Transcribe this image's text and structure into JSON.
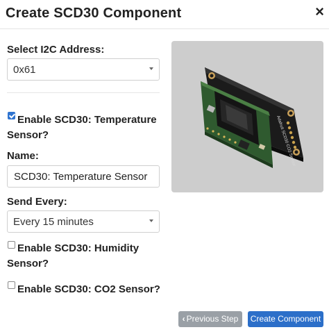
{
  "dialog": {
    "title": "Create SCD30 Component",
    "close_glyph": "×"
  },
  "form": {
    "i2c_label": "Select I2C Address:",
    "i2c_value": "0x61",
    "temp_checkbox": {
      "label": "Enable SCD30: Temperature Sensor?",
      "checked": true
    },
    "name_label": "Name:",
    "name_value": "SCD30: Temperature Sensor",
    "send_every_label": "Send Every:",
    "send_every_value": "Every 15 minutes",
    "humidity_checkbox": {
      "label": "Enable SCD30: Humidity Sensor?",
      "checked": false
    },
    "co2_checkbox": {
      "label": "Enable SCD30: CO2 Sensor?",
      "checked": false
    }
  },
  "image": {
    "board_text": "Adafruit SCD30 CO2 Sensor"
  },
  "footer": {
    "prev_label": "Previous Step",
    "create_label": "Create Component"
  },
  "colors": {
    "primary": "#2c6fc9",
    "secondary": "#9aa0a6",
    "checkbox_checked": "#2f74d0",
    "image_bg": "#cdcdcd"
  }
}
